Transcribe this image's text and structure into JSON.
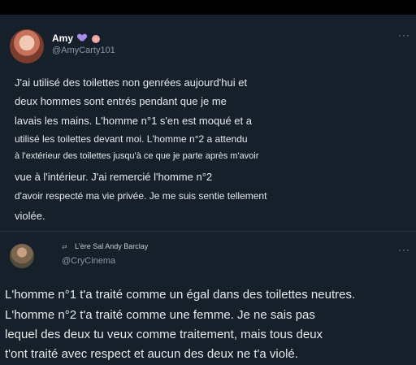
{
  "post1": {
    "name": "Amy",
    "handle": "@AmyCarty101",
    "emoji": [
      "purple-heart",
      "flower"
    ],
    "lines": [
      "J'ai utilisé des toilettes non genrées aujourd'hui et",
      "deux hommes sont entrés pendant que je me",
      "lavais les mains. L'homme n°1 s'en est moqué et a",
      "utilisé les toilettes devant moi. L'homme n°2 a attendu",
      "à l'extérieur des toilettes jusqu'à ce que je parte après m'avoir",
      "vue à l'intérieur. J'ai remercié l'homme n°2",
      "d'avoir respecté ma vie privée. Je me suis sentie tellement",
      "violée."
    ]
  },
  "post2": {
    "name": "L'ère Sal Andy Barclay",
    "handle": "@CryCinema",
    "lines": [
      "L'homme n°1 t'a traité comme un égal dans des toilettes neutres.",
      "L'homme n°2 t'a traité comme une femme. Je ne sais pas",
      "lequel des deux tu veux comme traitement, mais tous deux",
      "t'ont traité avec respect et aucun des deux ne t'a violé."
    ]
  },
  "more_label": "···",
  "colors": {
    "background": "#15202b",
    "text": "#e7e9ea",
    "muted": "#8b98a5"
  }
}
